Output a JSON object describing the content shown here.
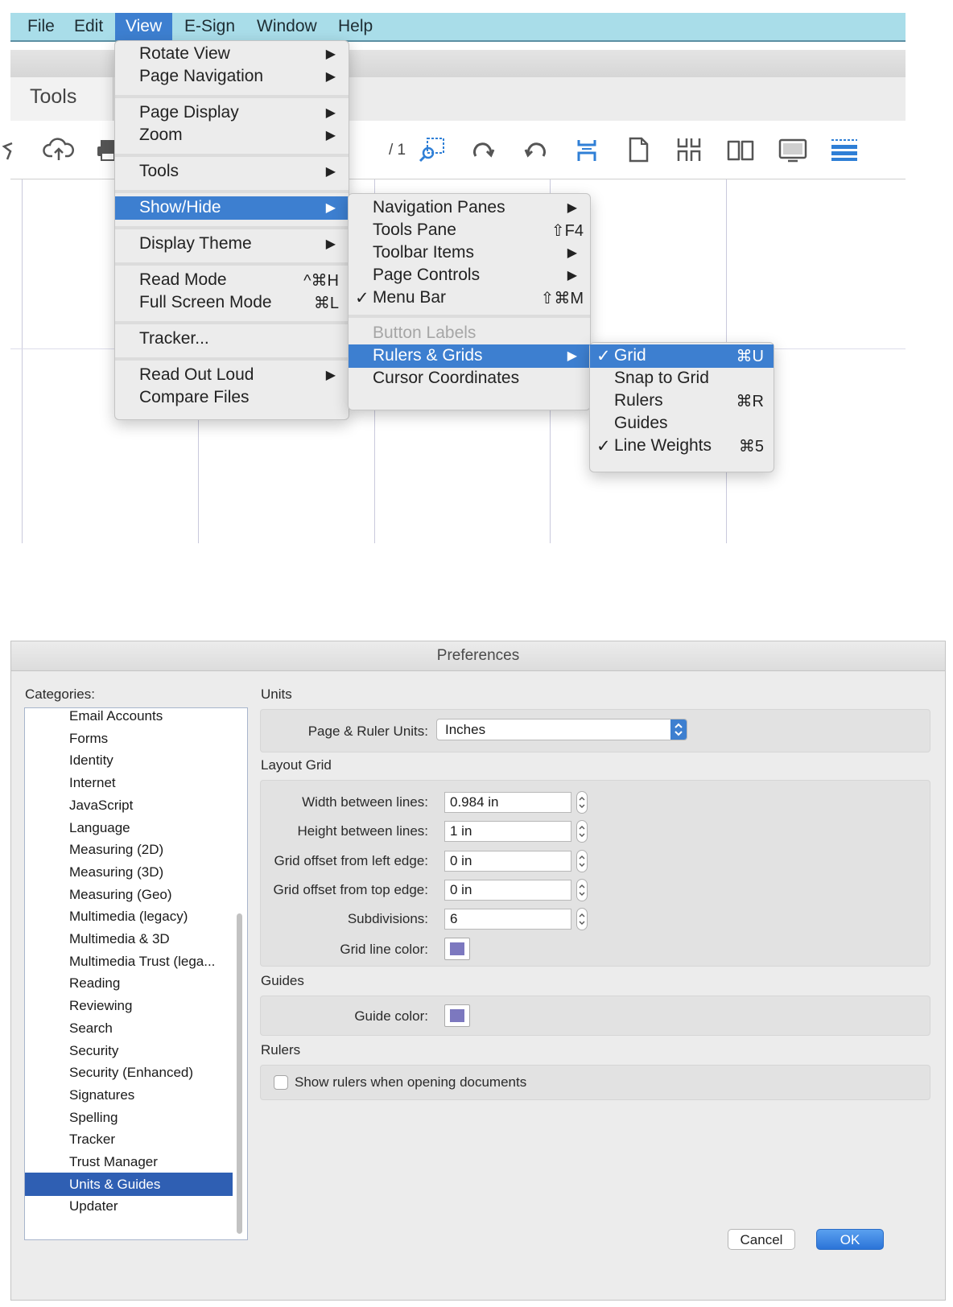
{
  "menubar": {
    "items": [
      "File",
      "Edit",
      "View",
      "E-Sign",
      "Window",
      "Help"
    ],
    "active": "View"
  },
  "tabs": {
    "tools_label": "Tools"
  },
  "toolbar": {
    "page_count": "/ 1",
    "icons": [
      "star-icon",
      "upload-cloud-icon",
      "print-icon",
      "zoom-marquee-icon",
      "rotate-clockwise-icon",
      "rotate-counterclockwise-icon",
      "fit-width-icon",
      "single-page-icon",
      "two-page-scroll-icon",
      "two-page-icon",
      "presentation-icon",
      "scrolling-mode-icon"
    ],
    "accent_color": "#2f7fd6"
  },
  "view_menu": {
    "items": [
      {
        "label": "Rotate View",
        "submenu": true
      },
      {
        "label": "Page Navigation",
        "submenu": true
      },
      {
        "label": "Page Display",
        "submenu": true
      },
      {
        "label": "Zoom",
        "submenu": true
      },
      {
        "label": "Tools",
        "submenu": true
      },
      {
        "label": "Show/Hide",
        "submenu": true,
        "highlighted": true
      },
      {
        "label": "Display Theme",
        "submenu": true
      },
      {
        "label": "Read Mode",
        "shortcut": "^⌘H"
      },
      {
        "label": "Full Screen Mode",
        "shortcut": "⌘L"
      },
      {
        "label": "Tracker..."
      },
      {
        "label": "Read Out Loud",
        "submenu": true
      },
      {
        "label": "Compare Files"
      }
    ],
    "arrow": "▶"
  },
  "show_hide_menu": {
    "items": [
      {
        "label": "Navigation Panes",
        "submenu": true
      },
      {
        "label": "Tools Pane",
        "shortcut": "⇧F4"
      },
      {
        "label": "Toolbar Items",
        "submenu": true
      },
      {
        "label": "Page Controls",
        "submenu": true
      },
      {
        "label": "Menu Bar",
        "shortcut": "⇧⌘M",
        "checked": true
      },
      {
        "label": "Button Labels",
        "disabled": true
      },
      {
        "label": "Rulers & Grids",
        "submenu": true,
        "highlighted": true
      },
      {
        "label": "Cursor Coordinates"
      }
    ],
    "check": "✓"
  },
  "rulers_grids_menu": {
    "items": [
      {
        "label": "Grid",
        "shortcut": "⌘U",
        "checked": true,
        "highlighted": true
      },
      {
        "label": "Snap to Grid"
      },
      {
        "label": "Rulers",
        "shortcut": "⌘R"
      },
      {
        "label": "Guides"
      },
      {
        "label": "Line Weights",
        "shortcut": "⌘5",
        "checked": true
      }
    ]
  },
  "preferences": {
    "title": "Preferences",
    "categories_label": "Categories:",
    "categories": [
      "Email Accounts",
      "Forms",
      "Identity",
      "Internet",
      "JavaScript",
      "Language",
      "Measuring (2D)",
      "Measuring (3D)",
      "Measuring (Geo)",
      "Multimedia (legacy)",
      "Multimedia & 3D",
      "Multimedia Trust (lega...",
      "Reading",
      "Reviewing",
      "Search",
      "Security",
      "Security (Enhanced)",
      "Signatures",
      "Spelling",
      "Tracker",
      "Trust Manager",
      "Units & Guides",
      "Updater"
    ],
    "selected_category": "Units & Guides",
    "units": {
      "section": "Units",
      "label": "Page & Ruler Units:",
      "value": "Inches"
    },
    "layout_grid": {
      "section": "Layout Grid",
      "fields": [
        {
          "label": "Width between lines:",
          "value": "0.984 in"
        },
        {
          "label": "Height between lines:",
          "value": "1 in"
        },
        {
          "label": "Grid offset from left edge:",
          "value": "0 in"
        },
        {
          "label": "Grid offset from top edge:",
          "value": "0 in"
        },
        {
          "label": "Subdivisions:",
          "value": "6"
        }
      ],
      "color_label": "Grid line color:",
      "color": "#7c78bf"
    },
    "guides": {
      "section": "Guides",
      "color_label": "Guide color:",
      "color": "#7c78bf"
    },
    "rulers": {
      "section": "Rulers",
      "checkbox_label": "Show rulers when opening documents",
      "checked": false
    },
    "buttons": {
      "cancel": "Cancel",
      "ok": "OK"
    }
  }
}
